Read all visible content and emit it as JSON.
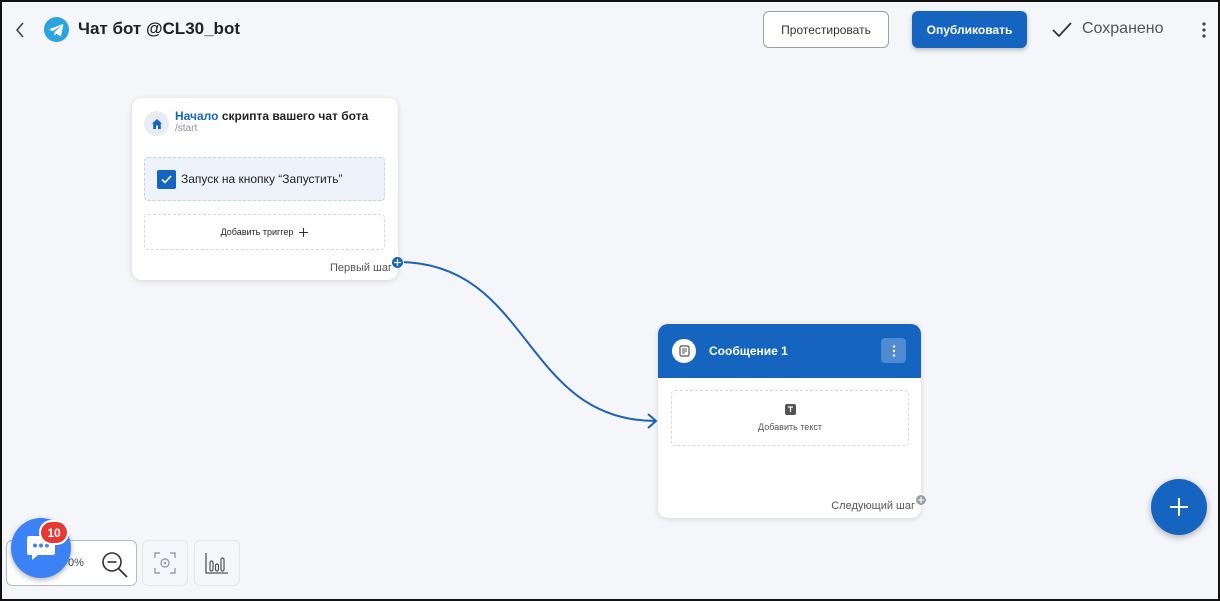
{
  "header": {
    "title": "Чат бот @CL30_bot",
    "test_button": "Протестировать",
    "publish_button": "Опубликовать",
    "saved_status": "Сохранено"
  },
  "start_node": {
    "title_highlight": "Начало",
    "title_rest": " скрипта вашего чат бота",
    "command": "/start",
    "trigger_label": "Запуск на кнопку “Запустить”",
    "add_trigger": "Добавить триггер",
    "first_step": "Первый шаг"
  },
  "message_node": {
    "title": "Сообщение 1",
    "add_text": "Добавить текст",
    "next_step": "Следующий шаг"
  },
  "zoom": {
    "level": "0%"
  },
  "chat_widget": {
    "badge_count": "10"
  },
  "colors": {
    "accent": "#1565c0",
    "canvas": "#f5f6fa",
    "badge": "#e53935",
    "telegram": "#2aa3e0",
    "chat_widget": "#3b82f6"
  },
  "icons": {
    "back": "chevron-left-icon",
    "brand": "telegram-icon",
    "saved": "check-icon",
    "menu": "kebab-menu-icon",
    "start_node": "home-icon",
    "message_node": "message-icon",
    "add_text": "text-icon",
    "add": "plus-icon",
    "zoom_out": "zoom-out-icon",
    "focus": "focus-icon",
    "stats": "bar-chart-icon",
    "chat": "chat-bubble-icon"
  }
}
